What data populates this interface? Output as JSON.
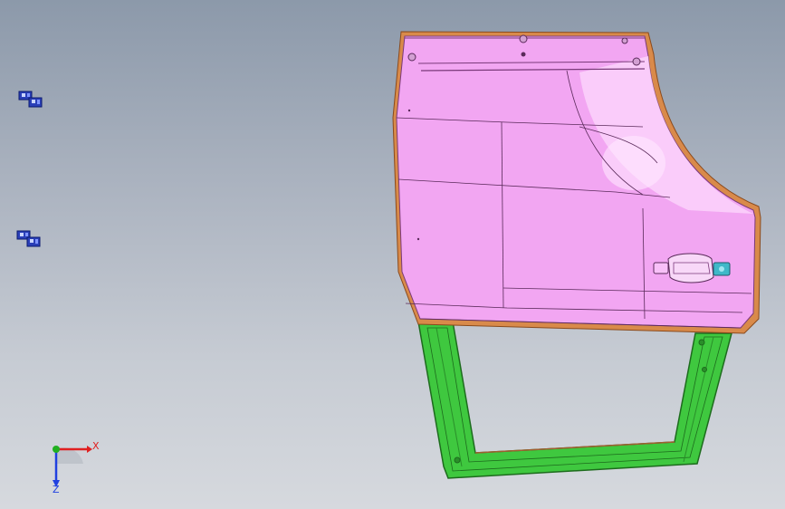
{
  "viewer": {
    "background_top": "#8c99aa",
    "background_bottom": "#d6d9de"
  },
  "tree_icons": [
    {
      "name": "part-spec-icon"
    },
    {
      "name": "product-spec-icon"
    }
  ],
  "model": {
    "panel_color": "#f2a6f2",
    "frame_color": "#3fc83f",
    "edge_color": "#d98a4a"
  },
  "compass": {
    "x_label": "X",
    "z_label": "Z",
    "x_color": "#e02020",
    "y_color": "#20b020",
    "z_color": "#2040e0"
  }
}
